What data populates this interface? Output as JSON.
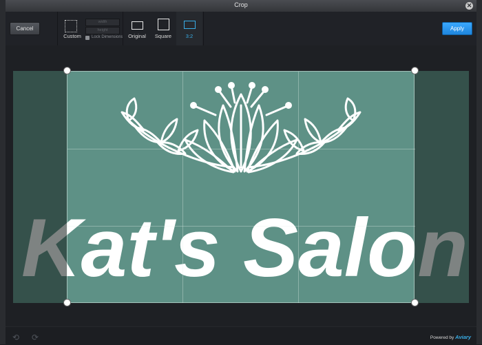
{
  "window": {
    "title": "Crop"
  },
  "toolbar": {
    "cancel_label": "Cancel",
    "apply_label": "Apply",
    "tools": {
      "custom": "Custom",
      "original": "Original",
      "square": "Square",
      "ratio": "3:2"
    },
    "width_placeholder": "width",
    "height_placeholder": "height",
    "lock_label": "Lock Dimensions",
    "active_tool": "3:2"
  },
  "image": {
    "logo_text": "Kat's Salon",
    "background_color": "#5e9186"
  },
  "footer": {
    "powered_by": "Powered by",
    "brand": "Aviary"
  },
  "colors": {
    "accent": "#39aee8",
    "apply": "#2196f3"
  },
  "icons": {
    "undo": "undo-arrow-icon",
    "redo": "redo-arrow-icon",
    "close": "close-icon"
  }
}
